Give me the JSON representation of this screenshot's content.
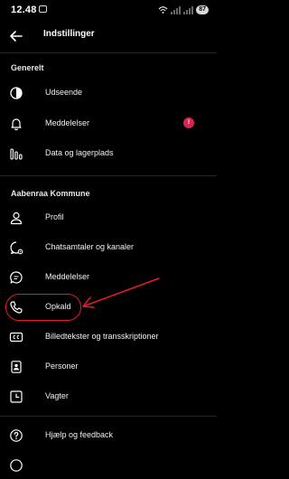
{
  "status_bar": {
    "time": "12.48",
    "battery": "87"
  },
  "header": {
    "title": "Indstillinger"
  },
  "sections": {
    "general": {
      "title": "Generelt",
      "items": [
        {
          "label": "Udseende",
          "icon": "appearance-icon"
        },
        {
          "label": "Meddelelser",
          "icon": "bell-icon",
          "badge": "!"
        },
        {
          "label": "Data og lagerplads",
          "icon": "data-storage-icon"
        }
      ]
    },
    "org": {
      "title": "Aabenraa Kommune",
      "items": [
        {
          "label": "Profil",
          "icon": "profile-icon"
        },
        {
          "label": "Chatsamtaler og kanaler",
          "icon": "chat-settings-icon"
        },
        {
          "label": "Meddelelser",
          "icon": "message-icon"
        },
        {
          "label": "Opkald",
          "icon": "phone-icon",
          "highlighted": true
        },
        {
          "label": "Billedtekster og transskriptioner",
          "icon": "captions-icon"
        },
        {
          "label": "Personer",
          "icon": "contacts-icon"
        },
        {
          "label": "Vagter",
          "icon": "shifts-icon"
        }
      ]
    },
    "help": {
      "items": [
        {
          "label": "Hjælp og feedback",
          "icon": "help-icon"
        }
      ]
    }
  },
  "colors": {
    "background": "#000000",
    "badge": "#d6254f",
    "annotation": "#e8192c",
    "divider": "#262626"
  }
}
